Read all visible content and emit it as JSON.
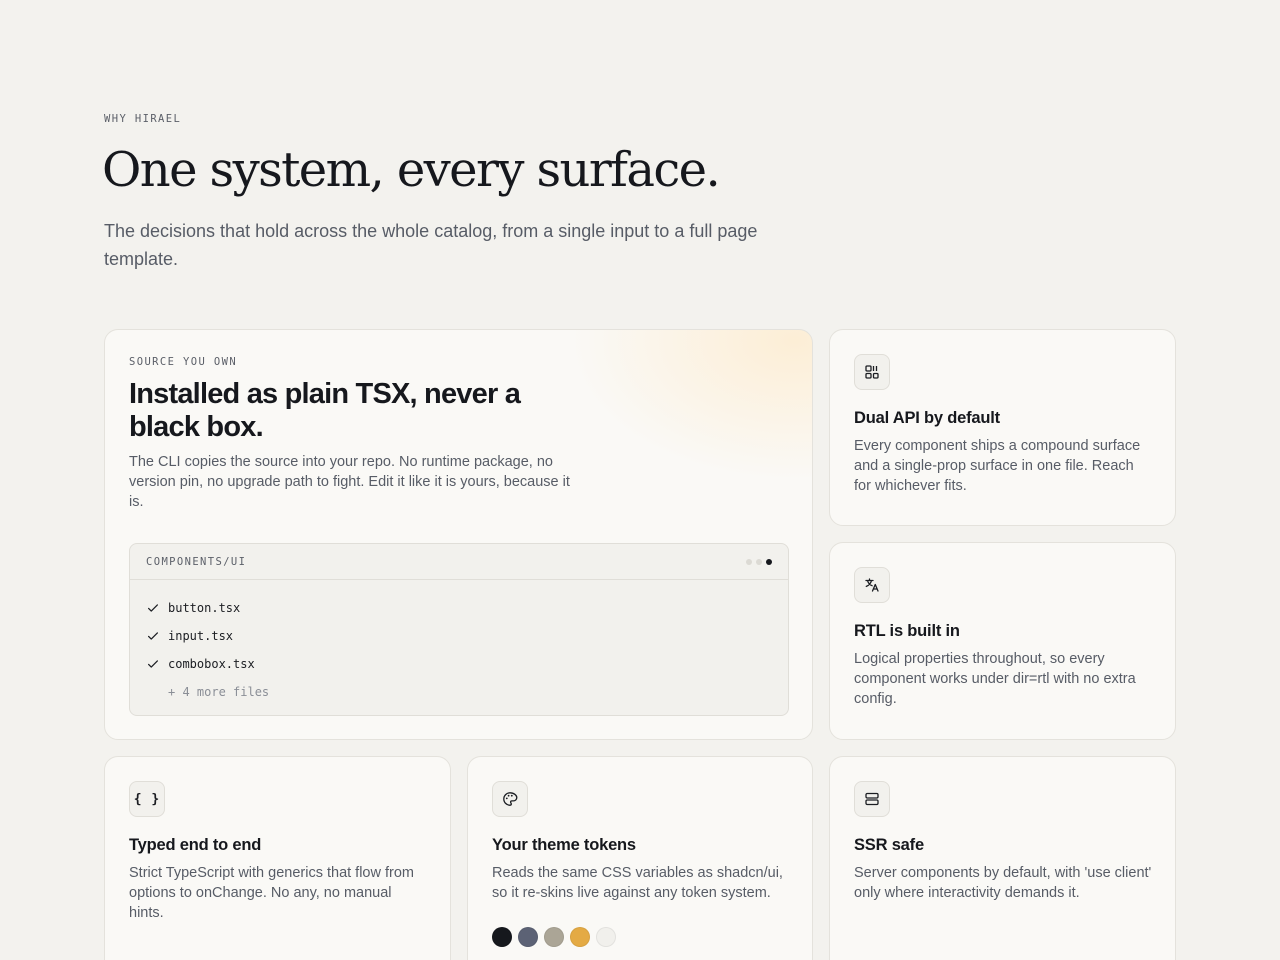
{
  "section": {
    "eyebrow": "WHY HIRAEL",
    "title": "One system, every surface.",
    "subtitle": "The decisions that hold across the whole catalog, from a single input to a full page template."
  },
  "source_card": {
    "eyebrow": "SOURCE YOU OWN",
    "title": "Installed as plain TSX, never a black box.",
    "description": "The CLI copies the source into your repo. No runtime package, no version pin, no upgrade path to fight. Edit it like it is yours, because it is.",
    "panel": {
      "label": "COMPONENTS/UI",
      "files": [
        "button.tsx",
        "input.tsx",
        "combobox.tsx"
      ],
      "more": "+ 4 more files"
    }
  },
  "features": {
    "dual": {
      "icon": "layout-grid-icon",
      "title": "Dual API by default",
      "description": "Every component ships a compound surface and a single-prop surface in one file. Reach for whichever fits."
    },
    "rtl": {
      "icon": "languages-icon",
      "title": "RTL is built in",
      "description": "Logical properties throughout, so every component works under dir=rtl with no extra config."
    },
    "typed": {
      "icon": "braces-icon",
      "icon_text": "{ }",
      "title": "Typed end to end",
      "description": "Strict TypeScript with generics that flow from options to onChange. No any, no manual hints."
    },
    "theme": {
      "icon": "palette-icon",
      "title": "Your theme tokens",
      "description": "Reads the same CSS variables as shadcn/ui, so it re-skins live against any token system.",
      "swatches": [
        "#16181d",
        "#5c6275",
        "#aba596",
        "#e4aa44",
        "#f1f0ec"
      ]
    },
    "ssr": {
      "icon": "server-icon",
      "title": "SSR safe",
      "description": "Server components by default, with 'use client' only where interactivity demands it."
    }
  },
  "colors": {
    "background": "#f3f2ee",
    "card": "#faf9f6",
    "text": "#16181d",
    "muted": "#575c66"
  }
}
